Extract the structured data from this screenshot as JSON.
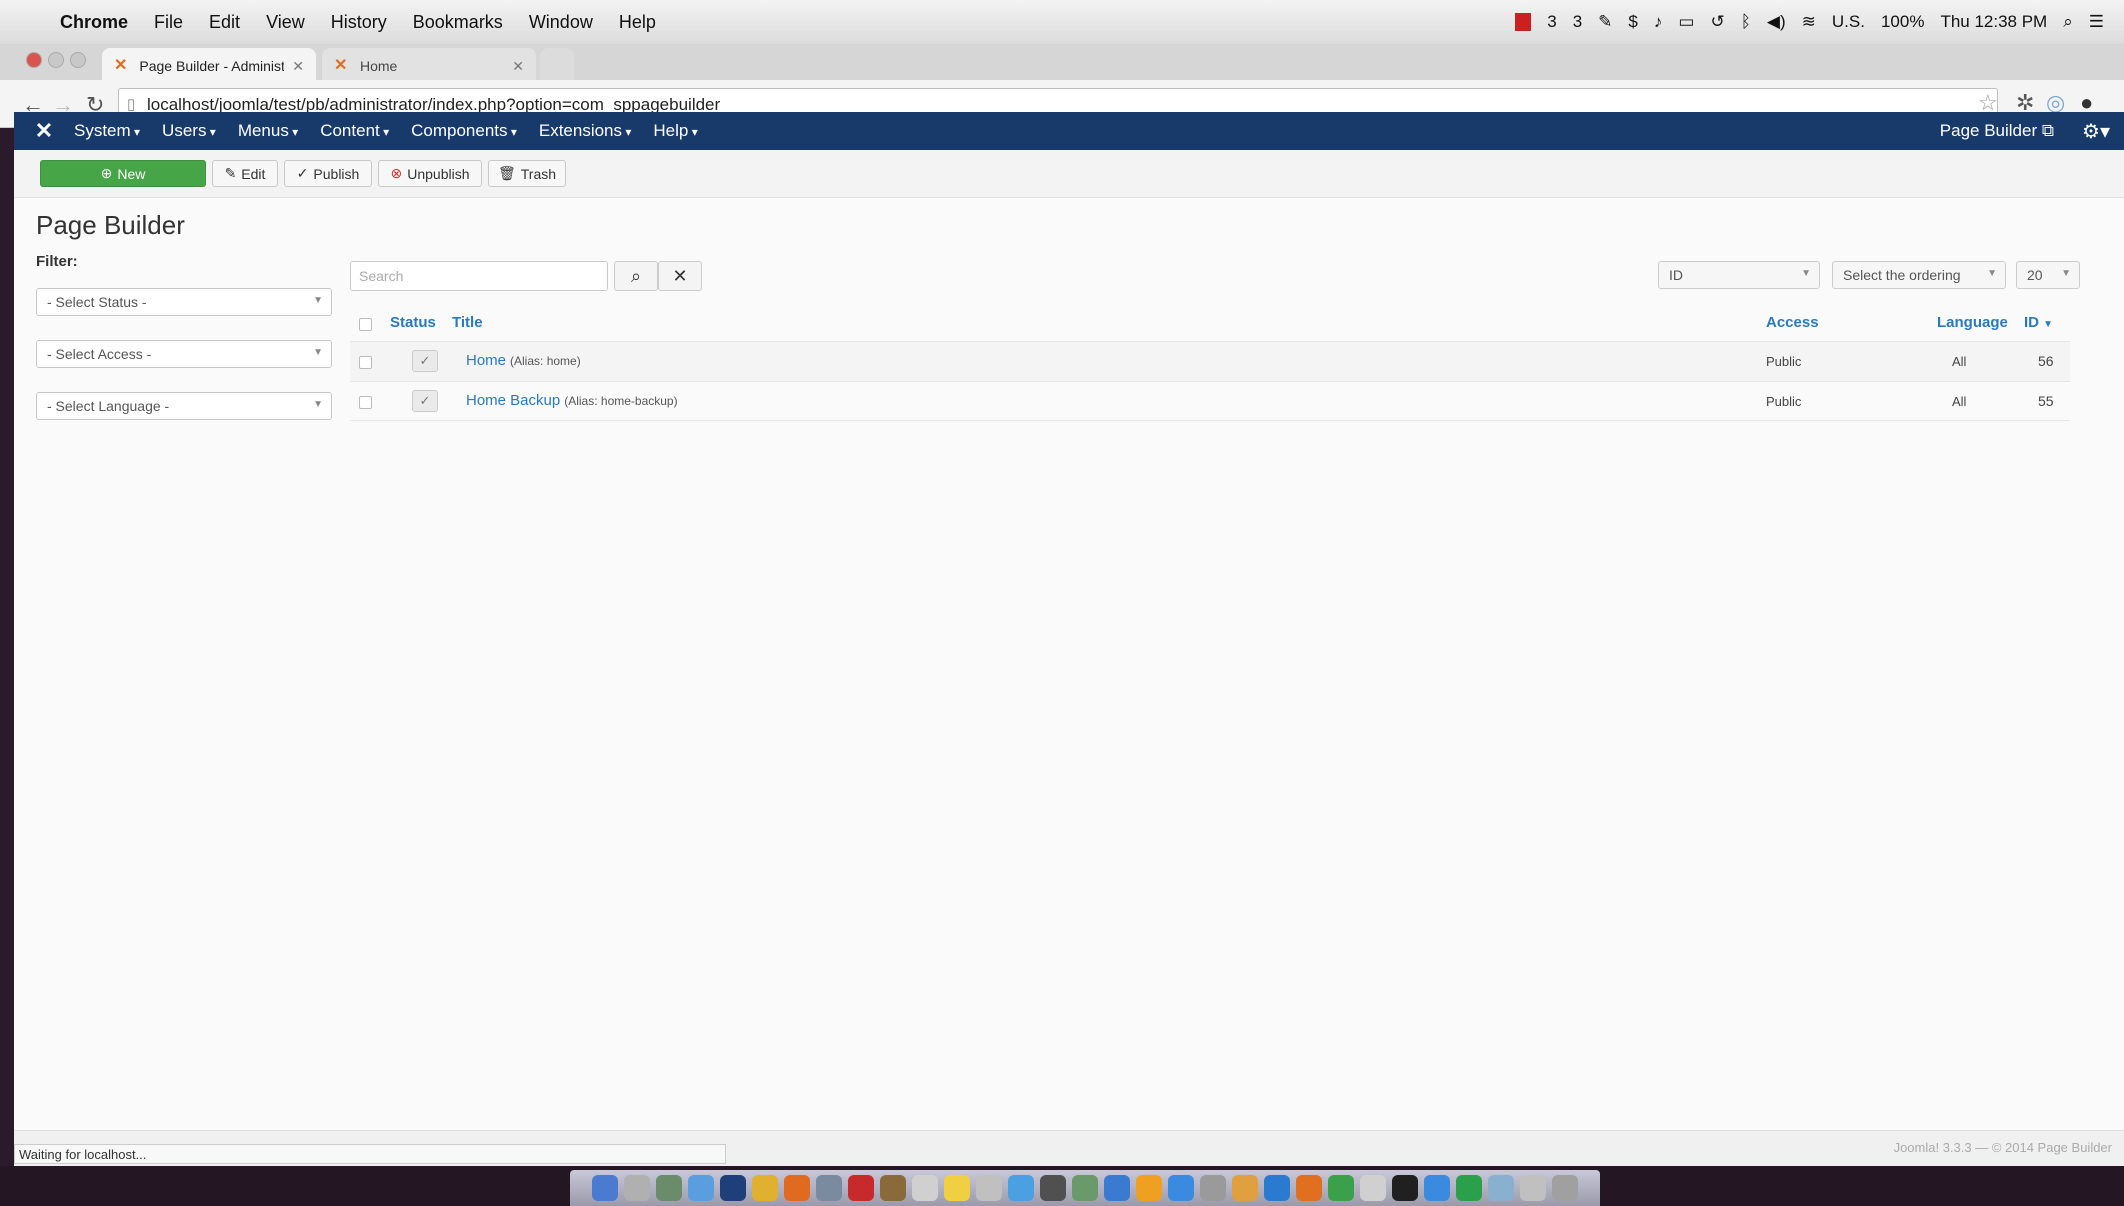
{
  "mac_menubar": {
    "app": "Chrome",
    "items": [
      "File",
      "Edit",
      "View",
      "History",
      "Bookmarks",
      "Window",
      "Help"
    ],
    "battery": "100%",
    "input_source": "U.S.",
    "clock": "Thu 12:38 PM",
    "status_counts": [
      "3",
      "3"
    ]
  },
  "browser": {
    "tabs": [
      {
        "title": "Page Builder - Administra",
        "active": true
      },
      {
        "title": "Home",
        "active": false
      }
    ],
    "url": "localhost/joomla/test/pb/administrator/index.php?option=com_sppagebuilder",
    "status_text": "Waiting for localhost..."
  },
  "joomla_nav": {
    "items": [
      "System",
      "Users",
      "Menus",
      "Content",
      "Components",
      "Extensions",
      "Help"
    ],
    "site_link": "Page Builder"
  },
  "toolbar": {
    "new_label": "New",
    "edit_label": "Edit",
    "publish_label": "Publish",
    "unpublish_label": "Unpublish",
    "trash_label": "Trash"
  },
  "page": {
    "title": "Page Builder",
    "filter_label": "Filter:",
    "filters": [
      "- Select Status -",
      "- Select Access -",
      "- Select Language -"
    ],
    "search_placeholder": "Search",
    "sort_field": "ID",
    "ordering": "Select the ordering",
    "limit": "20"
  },
  "table": {
    "headers": {
      "status": "Status",
      "title": "Title",
      "access": "Access",
      "language": "Language",
      "id": "ID"
    },
    "rows": [
      {
        "title": "Home",
        "alias": "(Alias: home)",
        "access": "Public",
        "language": "All",
        "id": "56"
      },
      {
        "title": "Home Backup",
        "alias": "(Alias: home-backup)",
        "access": "Public",
        "language": "All",
        "id": "55"
      }
    ]
  },
  "footer": {
    "copyright": "Joomla! 3.3.3 — © 2014 Page Builder"
  },
  "colors": {
    "nav_bg": "#183a6b",
    "new_button": "#46a546",
    "link": "#2a7abf"
  }
}
